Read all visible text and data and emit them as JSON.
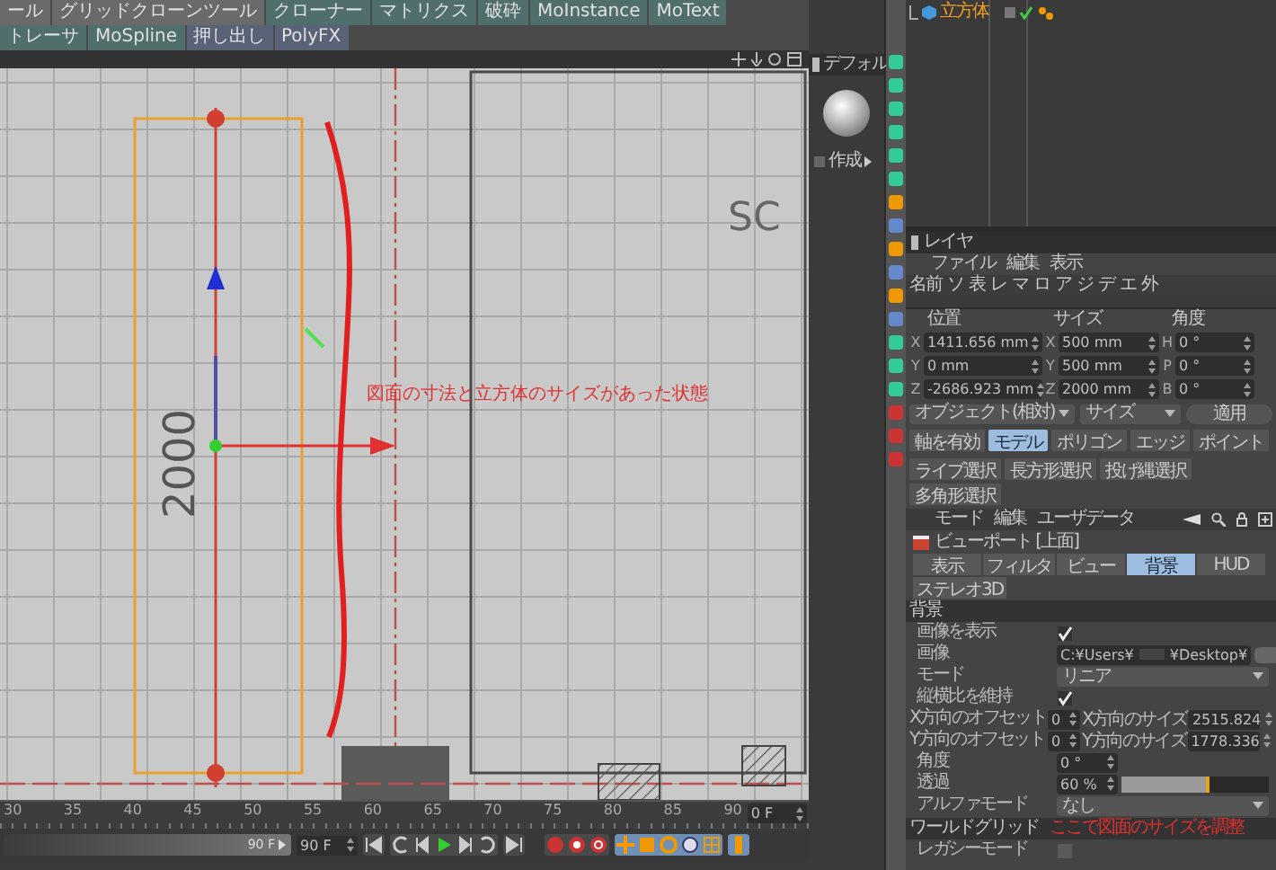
{
  "toolbar": {
    "groups": [
      {
        "items": [
          {
            "label": "ール"
          },
          {
            "label": "グリッドクローンツール"
          }
        ]
      },
      {
        "items": [
          {
            "label": "クローナー"
          },
          {
            "label": "マトリクス"
          },
          {
            "label": "破砕"
          },
          {
            "label": "MoInstance"
          },
          {
            "label": "MoText"
          },
          {
            "label": "トレーサ"
          },
          {
            "label": "MoSpline"
          }
        ]
      },
      {
        "items": [
          {
            "label": "押し出し"
          },
          {
            "label": "PolyFX"
          }
        ]
      }
    ]
  },
  "viewport": {
    "frame_label": "SC",
    "dimension_label": "2000",
    "annotation": "図面の寸法と立方体のサイズがあった状態"
  },
  "timeline": {
    "ticks": [
      "30",
      "35",
      "40",
      "45",
      "50",
      "55",
      "60",
      "65",
      "70",
      "75",
      "80",
      "85",
      "90"
    ],
    "current_frame": "0 F",
    "range": {
      "label": "90 F",
      "level": 1
    },
    "end_frame": "90 F"
  },
  "material_manager": {
    "material": "デフォル",
    "create_button": "作成"
  },
  "object_manager": {
    "objects": [
      {
        "name": "立方体",
        "enabled": true
      }
    ]
  },
  "layer_manager": {
    "title": "レイヤ",
    "menu": [
      "ファイル",
      "編集",
      "表示"
    ],
    "columns": [
      "名前",
      "ソ",
      "表",
      "レ",
      "マ",
      "ロ",
      "ア",
      "ジ",
      "デ",
      "エ",
      "外"
    ]
  },
  "coordinates": {
    "headers": [
      "位置",
      "サイズ",
      "角度"
    ],
    "rows": [
      {
        "position_axis": "X",
        "position": "1411.656 mm",
        "size_axis": "X",
        "size": "500 mm",
        "angle_axis": "H",
        "angle": "0 °"
      },
      {
        "position_axis": "Y",
        "position": "0 mm",
        "size_axis": "Y",
        "size": "500 mm",
        "angle_axis": "P",
        "angle": "0 °"
      },
      {
        "position_axis": "Z",
        "position": "-2686.923 mm",
        "size_axis": "Z",
        "size": "2000 mm",
        "angle_axis": "B",
        "angle": "0 °"
      }
    ],
    "dropdowns": [
      "オブジェクト(相対)",
      "サイズ"
    ],
    "apply_button": "適用"
  },
  "modes": [
    {
      "label": "軸を有効",
      "selected": false
    },
    {
      "label": "モデル",
      "selected": true
    },
    {
      "label": "ポリゴン",
      "selected": false
    },
    {
      "label": "エッジ",
      "selected": false
    },
    {
      "label": "ポイント",
      "selected": false
    }
  ],
  "selection_tools": [
    "ライブ選択",
    "長方形選択",
    "投げ縄選択",
    "多角形選択"
  ],
  "attributes": {
    "menu": [
      "モード",
      "編集",
      "ユーザデータ"
    ],
    "title": "ビューポート [上面]",
    "tabs": [
      {
        "label": "表示",
        "selected": false
      },
      {
        "label": "フィルタ",
        "selected": false
      },
      {
        "label": "ビュー",
        "selected": false
      },
      {
        "label": "背景",
        "selected": true
      },
      {
        "label": "HUD",
        "selected": false
      },
      {
        "label": "ステレオ3D",
        "selected": false
      }
    ],
    "section": "背景",
    "properties": [
      {
        "kind": "check",
        "label": "画像を表示",
        "checked": true
      },
      {
        "kind": "path",
        "label": "画像",
        "value_start": "C:¥Users¥",
        "value_end": "¥Desktop¥"
      },
      {
        "kind": "dropdown",
        "label": "モード",
        "value": "リニア"
      },
      {
        "kind": "check",
        "label": "縦横比を維持",
        "checked": true
      },
      {
        "kind": "pair",
        "label": "X方向のオフセット",
        "value": "0",
        "label2": "X方向のサイズ",
        "value2": "2515.824"
      },
      {
        "kind": "pair",
        "label": "Y方向のオフセット",
        "value": "0",
        "label2": "Y方向のサイズ",
        "value2": "1778.336"
      },
      {
        "kind": "number",
        "label": "角度",
        "value": "0 °"
      },
      {
        "kind": "slider",
        "label": "透過",
        "value": "60 %",
        "level": 0.6
      },
      {
        "kind": "dropdown",
        "label": "アルファモード",
        "value": "なし"
      },
      {
        "kind": "header",
        "label": "ワールドグリッド",
        "note": "ここで図面のサイズを調整"
      },
      {
        "kind": "check",
        "label": "レガシーモード",
        "checked": false
      }
    ]
  }
}
